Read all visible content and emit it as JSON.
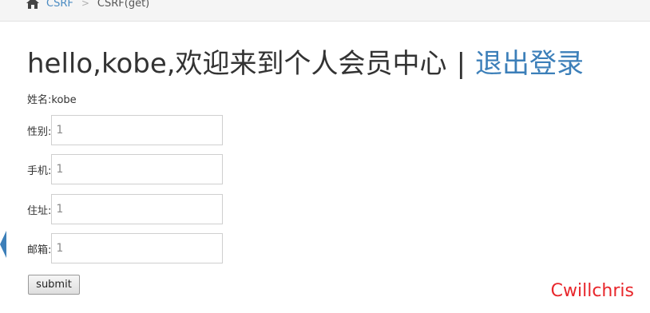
{
  "breadcrumb": {
    "home_icon": "home-icon",
    "link": "CSRF",
    "separator": ">",
    "current": "CSRF(get)"
  },
  "title": {
    "greeting": "hello,kobe,欢迎来到个人会员中心",
    "separator": "|",
    "logout": "退出登录"
  },
  "profile": {
    "name_label": "姓名:kobe"
  },
  "form": {
    "fields": [
      {
        "label": "性别:",
        "value": "1"
      },
      {
        "label": "手机:",
        "value": "1"
      },
      {
        "label": "住址:",
        "value": "1"
      },
      {
        "label": "邮箱:",
        "value": "1"
      }
    ],
    "submit_label": "submit"
  },
  "watermark": "Cwillchris",
  "colors": {
    "link": "#3c7fb9",
    "watermark": "#e8262b",
    "left_tab": "#3c7fb9"
  }
}
